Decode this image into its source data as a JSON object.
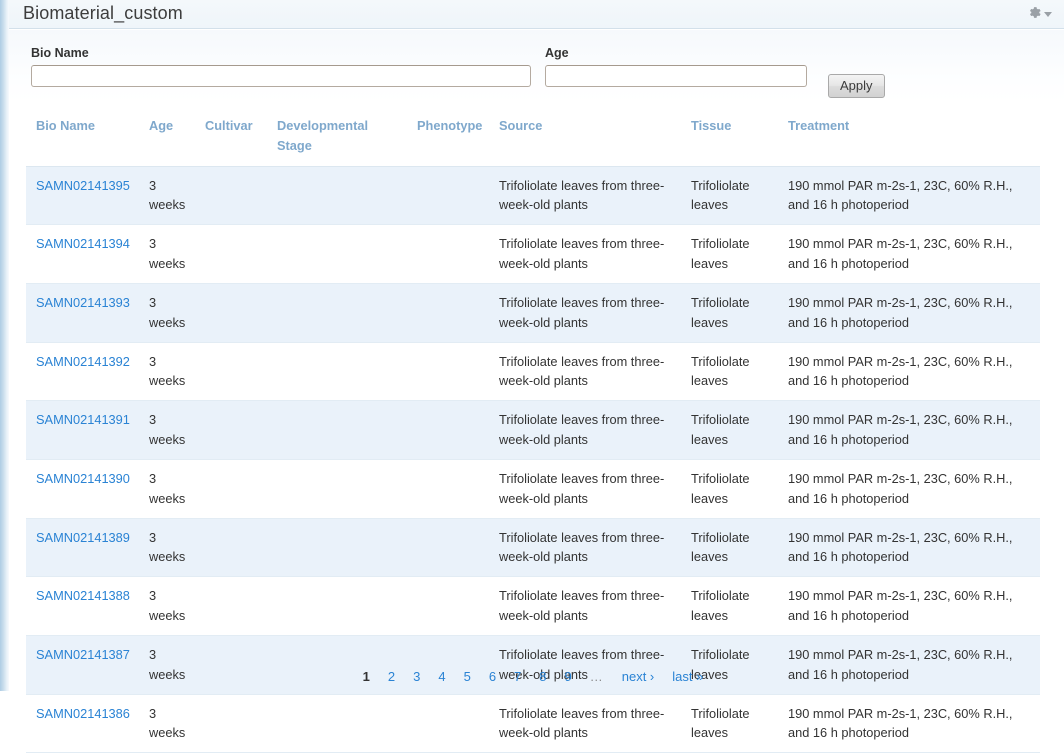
{
  "window": {
    "title": "Biomaterial_custom",
    "gear_icon": "gear-icon",
    "caret_icon": "chevron-down-icon"
  },
  "filters": {
    "bio_name": {
      "label": "Bio Name",
      "value": "",
      "placeholder": ""
    },
    "age": {
      "label": "Age",
      "value": "",
      "placeholder": ""
    },
    "apply_label": "Apply"
  },
  "table": {
    "columns": [
      "Bio Name",
      "Age",
      "Cultivar",
      "Developmental Stage",
      "Phenotype",
      "Source",
      "Tissue",
      "Treatment"
    ],
    "rows": [
      {
        "bio_name": "SAMN02141395",
        "age": "3 weeks",
        "cultivar": "",
        "developmental_stage": "",
        "phenotype": "",
        "source": "Trifoliolate leaves from three-week-old plants",
        "tissue": "Trifoliolate leaves",
        "treatment": "190 mmol PAR m-2s-1, 23C, 60% R.H., and 16 h photoperiod"
      },
      {
        "bio_name": "SAMN02141394",
        "age": "3 weeks",
        "cultivar": "",
        "developmental_stage": "",
        "phenotype": "",
        "source": "Trifoliolate leaves from three-week-old plants",
        "tissue": "Trifoliolate leaves",
        "treatment": "190 mmol PAR m-2s-1, 23C, 60% R.H., and 16 h photoperiod"
      },
      {
        "bio_name": "SAMN02141393",
        "age": "3 weeks",
        "cultivar": "",
        "developmental_stage": "",
        "phenotype": "",
        "source": "Trifoliolate leaves from three-week-old plants",
        "tissue": "Trifoliolate leaves",
        "treatment": "190 mmol PAR m-2s-1, 23C, 60% R.H., and 16 h photoperiod"
      },
      {
        "bio_name": "SAMN02141392",
        "age": "3 weeks",
        "cultivar": "",
        "developmental_stage": "",
        "phenotype": "",
        "source": "Trifoliolate leaves from three-week-old plants",
        "tissue": "Trifoliolate leaves",
        "treatment": "190 mmol PAR m-2s-1, 23C, 60% R.H., and 16 h photoperiod"
      },
      {
        "bio_name": "SAMN02141391",
        "age": "3 weeks",
        "cultivar": "",
        "developmental_stage": "",
        "phenotype": "",
        "source": "Trifoliolate leaves from three-week-old plants",
        "tissue": "Trifoliolate leaves",
        "treatment": "190 mmol PAR m-2s-1, 23C, 60% R.H., and 16 h photoperiod"
      },
      {
        "bio_name": "SAMN02141390",
        "age": "3 weeks",
        "cultivar": "",
        "developmental_stage": "",
        "phenotype": "",
        "source": "Trifoliolate leaves from three-week-old plants",
        "tissue": "Trifoliolate leaves",
        "treatment": "190 mmol PAR m-2s-1, 23C, 60% R.H., and 16 h photoperiod"
      },
      {
        "bio_name": "SAMN02141389",
        "age": "3 weeks",
        "cultivar": "",
        "developmental_stage": "",
        "phenotype": "",
        "source": "Trifoliolate leaves from three-week-old plants",
        "tissue": "Trifoliolate leaves",
        "treatment": "190 mmol PAR m-2s-1, 23C, 60% R.H., and 16 h photoperiod"
      },
      {
        "bio_name": "SAMN02141388",
        "age": "3 weeks",
        "cultivar": "",
        "developmental_stage": "",
        "phenotype": "",
        "source": "Trifoliolate leaves from three-week-old plants",
        "tissue": "Trifoliolate leaves",
        "treatment": "190 mmol PAR m-2s-1, 23C, 60% R.H., and 16 h photoperiod"
      },
      {
        "bio_name": "SAMN02141387",
        "age": "3 weeks",
        "cultivar": "",
        "developmental_stage": "",
        "phenotype": "",
        "source": "Trifoliolate leaves from three-week-old plants",
        "tissue": "Trifoliolate leaves",
        "treatment": "190 mmol PAR m-2s-1, 23C, 60% R.H., and 16 h photoperiod"
      },
      {
        "bio_name": "SAMN02141386",
        "age": "3 weeks",
        "cultivar": "",
        "developmental_stage": "",
        "phenotype": "",
        "source": "Trifoliolate leaves from three-week-old plants",
        "tissue": "Trifoliolate leaves",
        "treatment": "190 mmol PAR m-2s-1, 23C, 60% R.H., and 16 h photoperiod"
      }
    ]
  },
  "pagination": {
    "current": "1",
    "pages": [
      "1",
      "2",
      "3",
      "4",
      "5",
      "6",
      "7",
      "8",
      "9"
    ],
    "ellipsis": "…",
    "next_label": "next ›",
    "last_label": "last »"
  },
  "colors": {
    "link": "#2a83d4",
    "header_text": "#7fa8cc",
    "row_stripe": "#eaf2fa",
    "left_edge": "#aecde4"
  }
}
